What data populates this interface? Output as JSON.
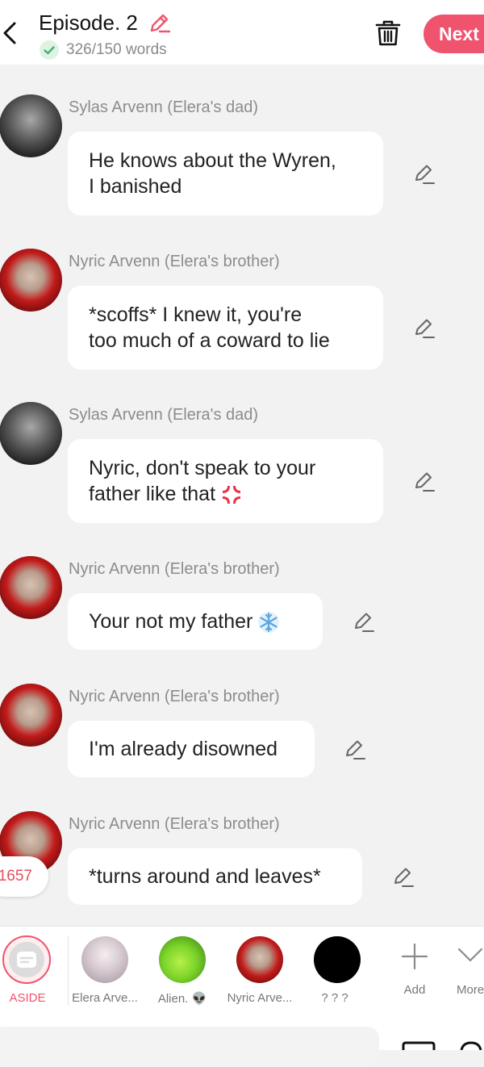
{
  "header": {
    "title": "Episode. 2",
    "word_count": "326/150 words",
    "next_label": "Next",
    "accent_color": "#f0536e",
    "check_color": "#3cb371"
  },
  "messages": [
    {
      "speaker": "Sylas Arvenn (Elera's dad)",
      "text": "He knows about the Wyren,\nI banished",
      "emoji": ""
    },
    {
      "speaker": "Nyric Arvenn (Elera's brother)",
      "text": "*scoffs* I knew it, you're\ntoo much of a coward to lie",
      "emoji": ""
    },
    {
      "speaker": "Sylas Arvenn (Elera's dad)",
      "text": "Nyric, don't speak to your\nfather like that",
      "emoji": "anger-symbol"
    },
    {
      "speaker": "Nyric Arvenn (Elera's brother)",
      "text": "Your not my father",
      "emoji": "snowflake"
    },
    {
      "speaker": "Nyric Arvenn (Elera's brother)",
      "text": "I'm already disowned",
      "emoji": ""
    },
    {
      "speaker": "Nyric Arvenn (Elera's brother)",
      "text": "*turns around and leaves*",
      "emoji": ""
    }
  ],
  "side_counter": "1657",
  "characters": [
    {
      "label": "ASIDE",
      "selected": true
    },
    {
      "label": "Elera Arve..."
    },
    {
      "label": "Alien. 👽"
    },
    {
      "label": "Nyric Arve..."
    },
    {
      "label": "? ? ?"
    },
    {
      "label": "Add"
    },
    {
      "label": "More"
    }
  ]
}
